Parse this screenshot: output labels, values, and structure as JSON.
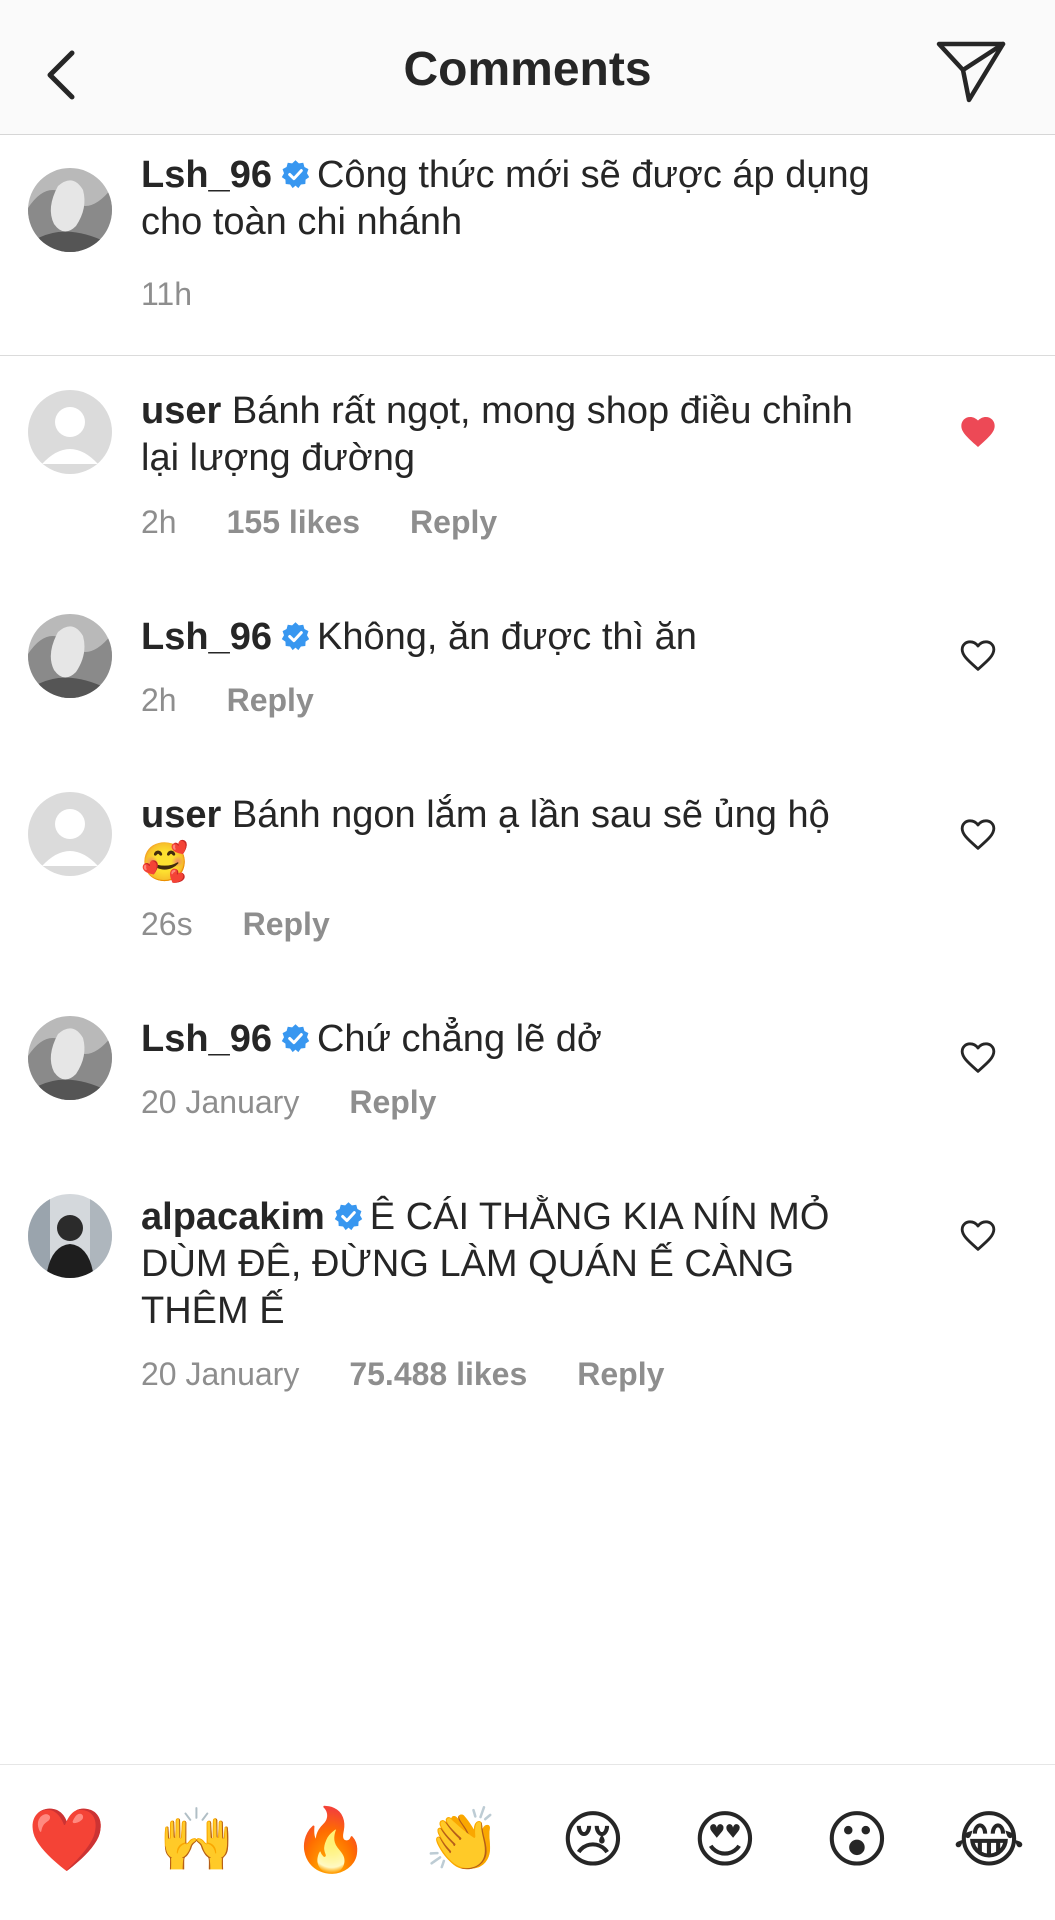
{
  "header": {
    "title": "Comments"
  },
  "caption": {
    "username": "Lsh_96",
    "text": "Công thức mới sẽ được áp dụng cho toàn chi nhánh",
    "time": "11h"
  },
  "comments": [
    {
      "username": "user",
      "text": "Bánh rất ngọt, mong shop điều chỉnh lại lượng đường",
      "time": "2h",
      "likes": "155 likes",
      "reply": "Reply",
      "liked": true
    },
    {
      "username": "Lsh_96",
      "text": "Không, ăn được thì ăn",
      "time": "2h",
      "reply": "Reply",
      "liked": false
    },
    {
      "username": "user",
      "text": "Bánh ngon lắm ạ lần sau sẽ ủng hộ",
      "emoji": "🥰",
      "time": "26s",
      "reply": "Reply",
      "liked": false
    },
    {
      "username": "Lsh_96",
      "text": "Chứ chẳng lẽ dở",
      "time": "20 January",
      "reply": "Reply",
      "liked": false
    },
    {
      "username": "alpacakim",
      "text": "Ê CÁI THẰNG KIA NÍN MỎ DÙM ĐÊ, ĐỪNG LÀM QUÁN Ế CÀNG THÊM Ế",
      "time": "20 January",
      "likes": "75.488 likes",
      "reply": "Reply",
      "liked": false
    }
  ],
  "emoji_bar": [
    "❤️",
    "🙌",
    "🔥",
    "👏",
    "😢",
    "😍",
    "😮",
    "😂"
  ],
  "colors": {
    "verified": "#3897f0",
    "liked_heart": "#ed4956",
    "meta_text": "#8e8e8e"
  }
}
